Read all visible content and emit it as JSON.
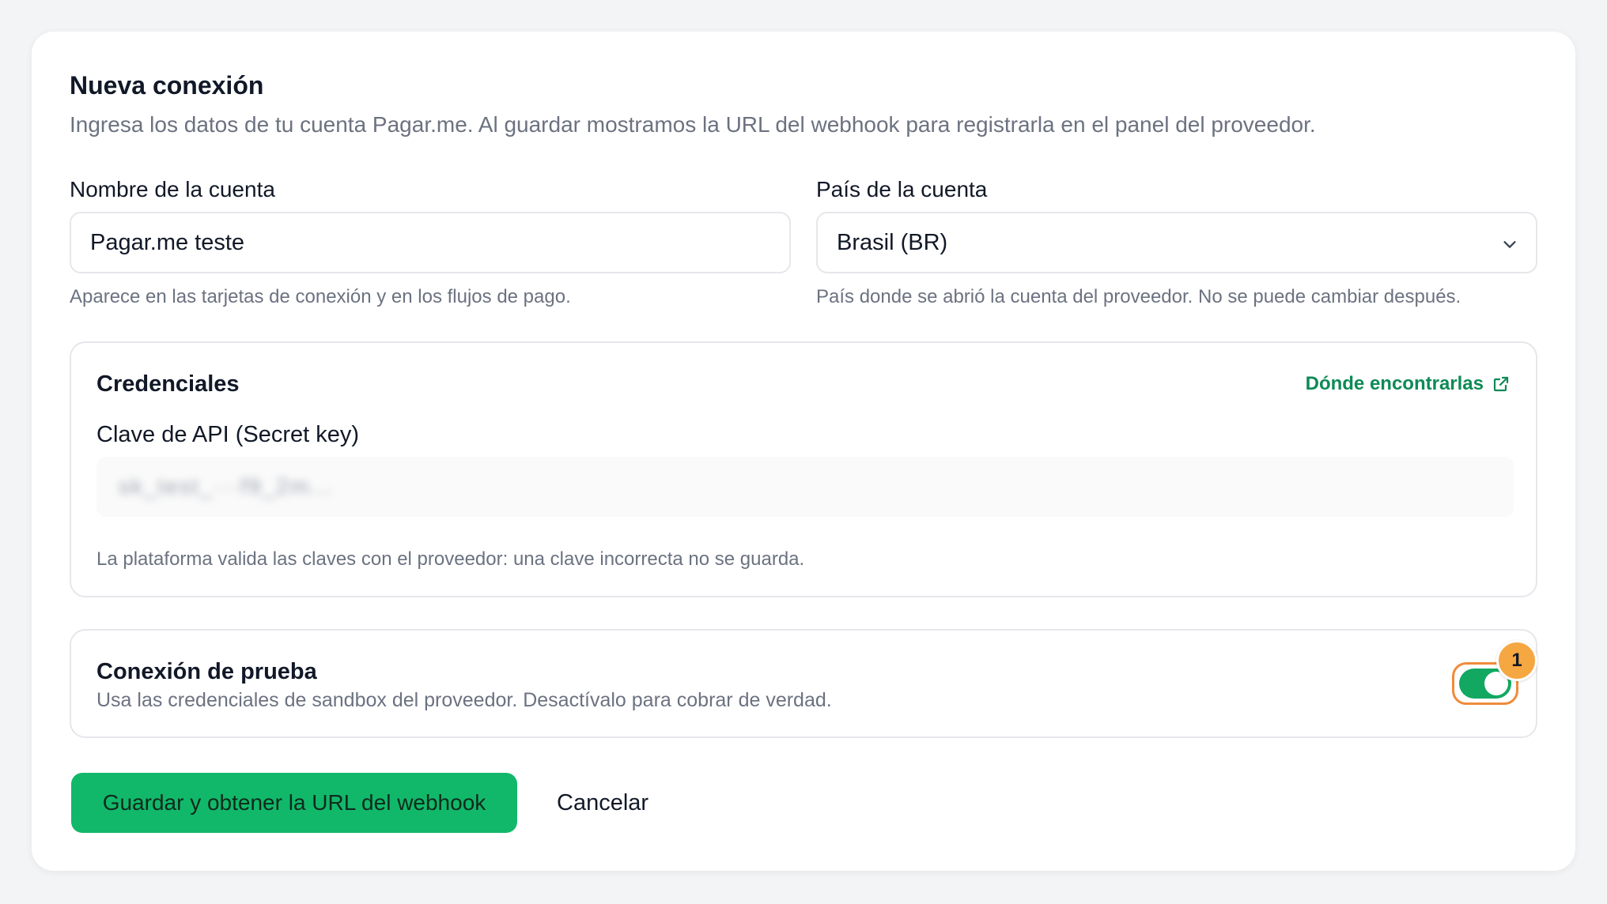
{
  "form": {
    "title": "Nueva conexión",
    "subtitle": "Ingresa los datos de tu cuenta Pagar.me. Al guardar mostramos la URL del webhook para registrarla en el panel del proveedor."
  },
  "account_name": {
    "label": "Nombre de la cuenta",
    "value": "Pagar.me teste",
    "help": "Aparece en las tarjetas de conexión y en los flujos de pago."
  },
  "account_country": {
    "label": "País de la cuenta",
    "value": "Brasil (BR)",
    "help": "País donde se abrió la cuenta del proveedor. No se puede cambiar después."
  },
  "credentials": {
    "title": "Credenciales",
    "link": "Dónde encontrarlas",
    "api_key_label": "Clave de API (Secret key)",
    "api_key_value": "sk_test_···f9_2m...",
    "help": "La plataforma valida las claves con el proveedor: una clave incorrecta no se guarda."
  },
  "test_connection": {
    "title": "Conexión de prueba",
    "description": "Usa las credenciales de sandbox del proveedor. Desactívalo para cobrar de verdad.",
    "enabled": true,
    "badge": "1"
  },
  "actions": {
    "save": "Guardar y obtener la URL del webhook",
    "cancel": "Cancelar"
  },
  "colors": {
    "accent": "#12b86a",
    "link": "#0e8a56",
    "highlight": "#f08b3a"
  }
}
